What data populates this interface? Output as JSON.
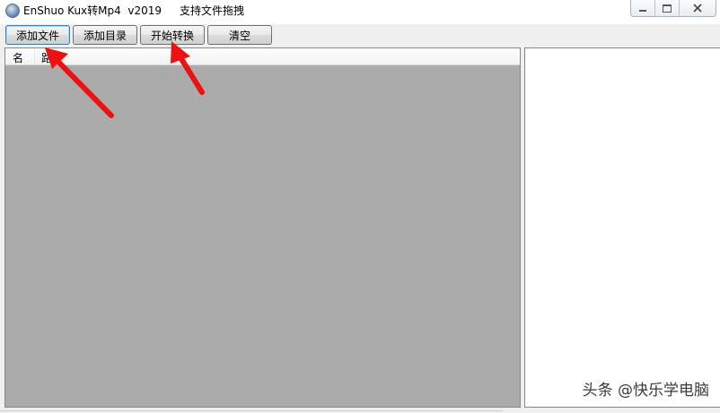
{
  "window": {
    "title": "EnShuo Kux转Mp4  v2019",
    "hint": "支持文件拖拽",
    "controls": {
      "minimize": "minimize-icon",
      "maximize": "maximize-icon",
      "close": "close-icon"
    }
  },
  "toolbar": {
    "add_file_label": "添加文件",
    "add_folder_label": "添加目录",
    "start_label": "开始转换",
    "clear_label": "清空"
  },
  "file_list": {
    "columns": [
      "名",
      "路"
    ],
    "rows": []
  },
  "watermark": "头条 @快乐学电脑",
  "colors": {
    "list_background": "#ababab",
    "annotation_arrow": "#ee1111",
    "focus_border": "#3c7fb1"
  }
}
